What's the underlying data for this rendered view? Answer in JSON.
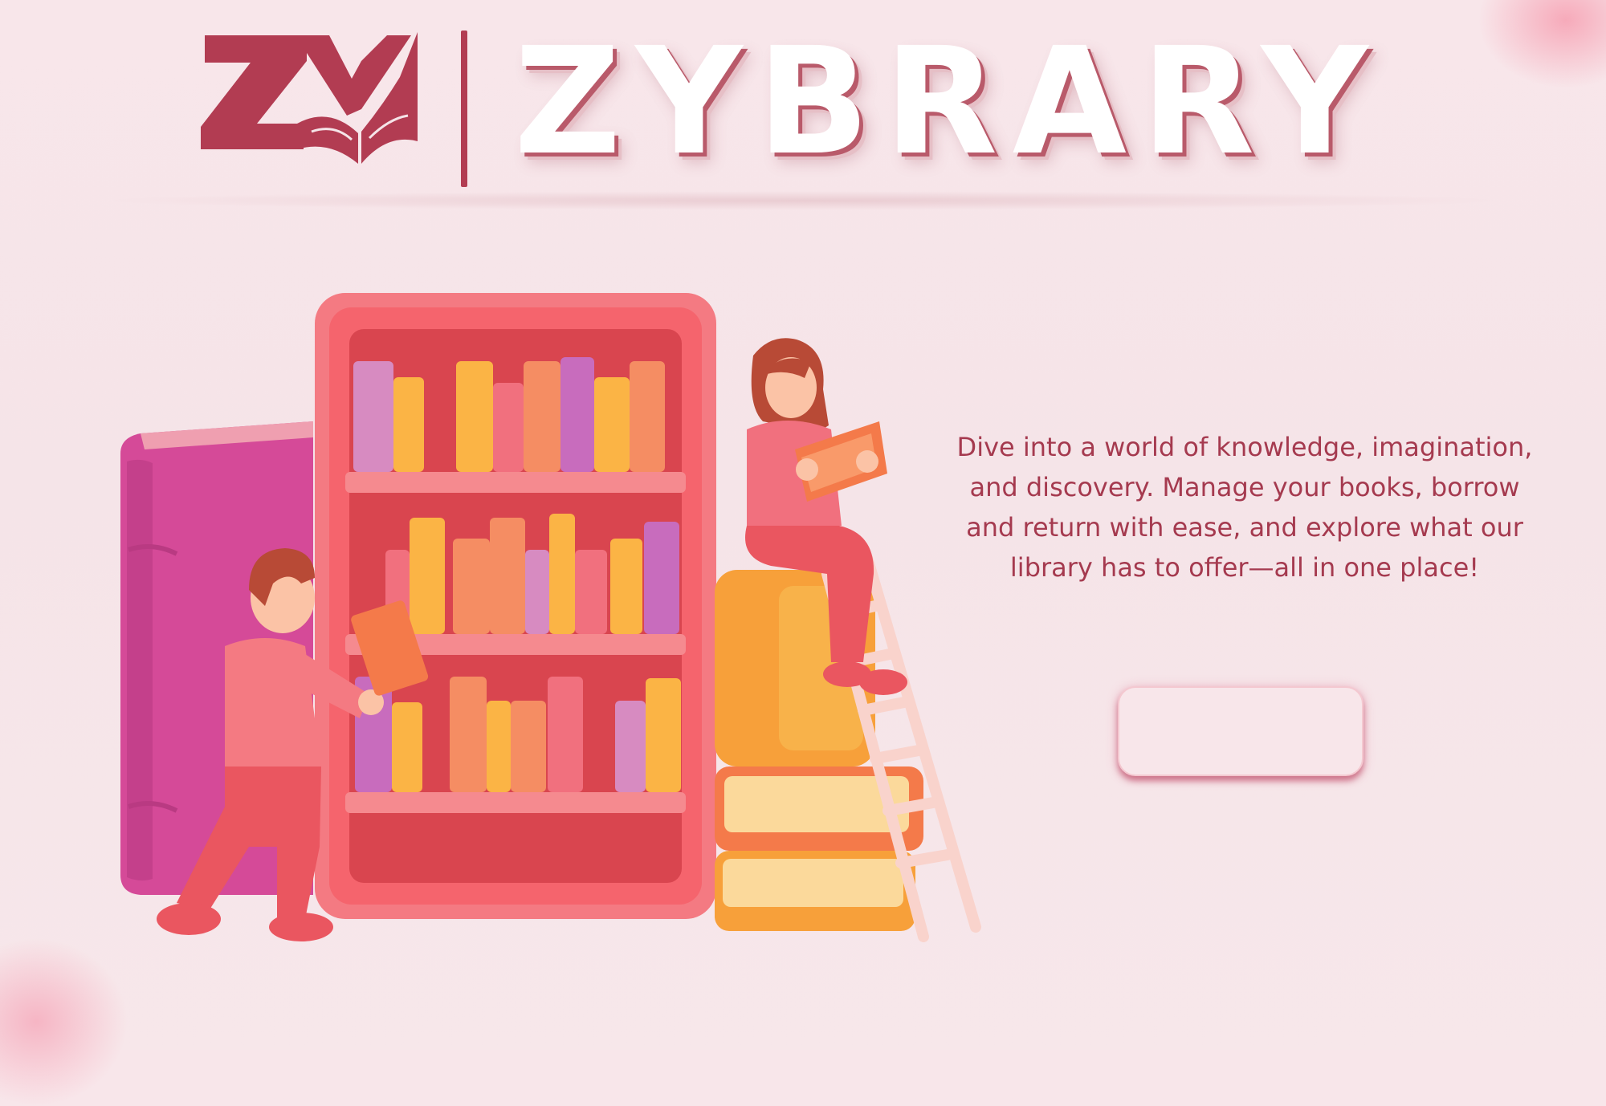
{
  "brand": {
    "title": "ZYBRARY",
    "logo_alt_mark": "ZY",
    "primary_color": "#b23c52"
  },
  "hero": {
    "tagline": "Dive into a world of knowledge, imagination, and discovery. Manage your books, borrow and return with ease, and explore what our library has to offer—all in one place!",
    "tagline_color": "#a53a4f",
    "cta_label": ""
  },
  "illustration": {
    "icon": "library-bookshelf-illustration",
    "colors": {
      "shelf": "#f26d78",
      "big_book": "#d94a9c",
      "accent_orange": "#f7a03a"
    }
  }
}
